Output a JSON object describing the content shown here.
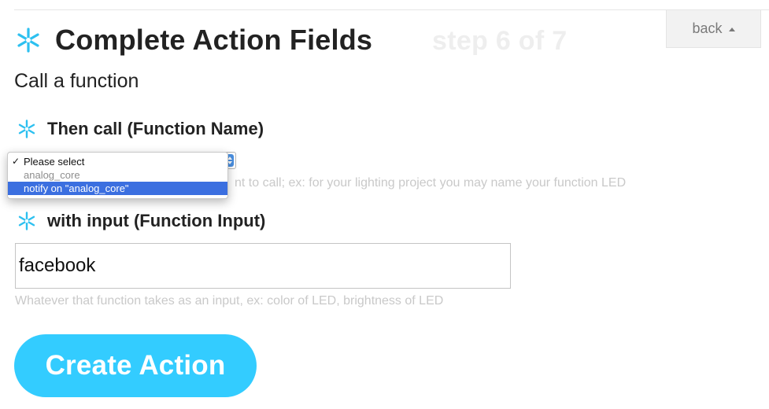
{
  "header": {
    "title": "Complete Action Fields",
    "step": "step 6 of 7",
    "subtitle": "Call a function",
    "back_label": "back"
  },
  "colors": {
    "accent": "#33ccff",
    "star": "#2dc0f0",
    "selected_option": "#3b6fe0"
  },
  "icons": {
    "title": "asterisk-star-icon",
    "field": "asterisk-star-icon",
    "back": "caret-up-icon"
  },
  "function_name_field": {
    "label": "Then call (Function Name)",
    "help": "Select the function you want to call; ex: for your lighting project you may name your function LED",
    "help_visible": "nt to call; ex: for your lighting project you may name your function LED",
    "dropdown": {
      "options": [
        {
          "label": "Please select",
          "checked": true,
          "disabled": false
        },
        {
          "label": "analog_core",
          "checked": false,
          "disabled": true
        },
        {
          "label": "notify on \"analog_core\"",
          "checked": false,
          "disabled": false,
          "highlighted": true
        }
      ]
    }
  },
  "function_input_field": {
    "label": "with input (Function Input)",
    "value": "facebook",
    "help": "Whatever that function takes as an input, ex: color of LED, brightness of LED"
  },
  "create_button": {
    "label": "Create Action"
  }
}
